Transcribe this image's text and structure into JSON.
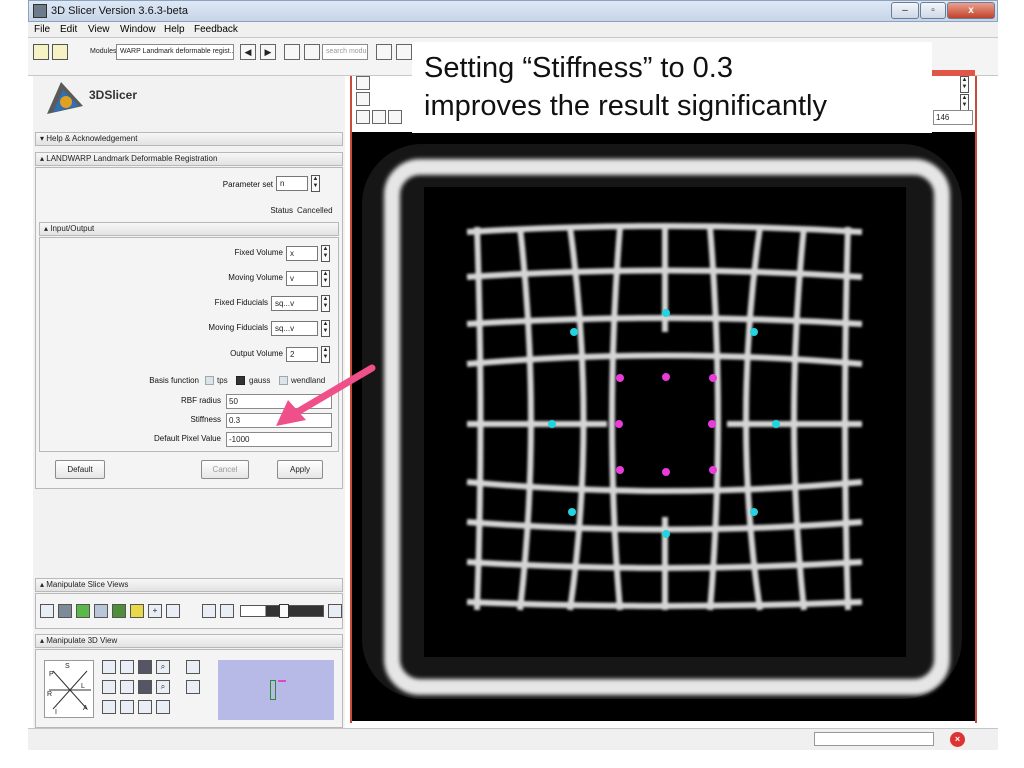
{
  "window": {
    "title": "3D Slicer Version 3.6.3-beta",
    "min": "–",
    "max": "▫",
    "close": "x"
  },
  "menu": [
    "File",
    "Edit",
    "View",
    "Window",
    "Help",
    "Feedback"
  ],
  "toolbar": {
    "modules_label": "Modules:",
    "module_value": "WARP Landmark deformable regist...",
    "search_placeholder": "search modules",
    "back": "◀",
    "forward": "▶"
  },
  "logo": {
    "text": "3DSlicer"
  },
  "sections": {
    "help": "Help & Acknowledgement",
    "landwarp": "LANDWARP Landmark Deformable Registration",
    "io": "Input/Output",
    "slice": "Manipulate Slice Views",
    "view3d": "Manipulate 3D View"
  },
  "params": {
    "parameter_set_label": "Parameter set",
    "parameter_set_value": "n",
    "status_label": "Status",
    "status_value": "Cancelled",
    "fixed_volume_label": "Fixed Volume",
    "fixed_volume_value": "x",
    "moving_volume_label": "Moving Volume",
    "moving_volume_value": "v",
    "fixed_fid_label": "Fixed Fiducials",
    "fixed_fid_value": "sq...v",
    "moving_fid_label": "Moving Fiducials",
    "moving_fid_value": "sq...v",
    "output_volume_label": "Output Volume",
    "output_volume_value": "2",
    "basis_label": "Basis function",
    "basis_options": [
      {
        "label": "tps",
        "checked": false
      },
      {
        "label": "gauss",
        "checked": true
      },
      {
        "label": "wendland",
        "checked": false
      }
    ],
    "rbf_label": "RBF radius",
    "rbf_value": "50",
    "stiffness_label": "Stiffness",
    "stiffness_value": "0.3",
    "pixel_label": "Default Pixel Value",
    "pixel_value": "-1000"
  },
  "buttons": {
    "default": "Default",
    "cancel": "Cancel",
    "apply": "Apply"
  },
  "orient": {
    "p": "P",
    "s": "S",
    "r": "R",
    "l": "L",
    "i": "I",
    "a": "A"
  },
  "view": {
    "slice_value": "146"
  },
  "note": {
    "line1": "Setting “Stiffness” to 0.3",
    "line2": "improves the result significantly"
  },
  "colors": {
    "arrow": "#f0508a",
    "cyan": "#22d3e0",
    "magenta": "#e83cd8",
    "frame": "#c94b39"
  }
}
